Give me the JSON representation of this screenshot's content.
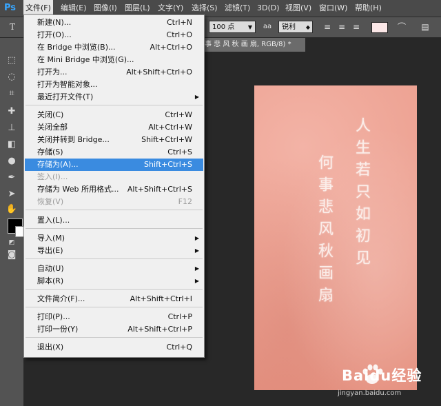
{
  "app": {
    "logo": "Ps"
  },
  "menubar": {
    "items": [
      "文件(F)",
      "编辑(E)",
      "图像(I)",
      "图层(L)",
      "文字(Y)",
      "选择(S)",
      "滤镜(T)",
      "3D(D)",
      "视图(V)",
      "窗口(W)",
      "帮助(H)"
    ],
    "active_index": 0
  },
  "options": {
    "tool_glyph": "T",
    "font_size": "100 点",
    "aa_label": "aa",
    "aa_mode": "锐利"
  },
  "document": {
    "tab_title": "事 悲 风 秋 画 扇, RGB/8) *",
    "poem_right": "人生若只如初见",
    "poem_left": "何事悲风秋画扇"
  },
  "file_menu": {
    "items": [
      {
        "label": "新建(N)...",
        "shortcut": "Ctrl+N"
      },
      {
        "label": "打开(O)...",
        "shortcut": "Ctrl+O"
      },
      {
        "label": "在 Bridge 中浏览(B)...",
        "shortcut": "Alt+Ctrl+O"
      },
      {
        "label": "在 Mini Bridge 中浏览(G)...",
        "shortcut": ""
      },
      {
        "label": "打开为...",
        "shortcut": "Alt+Shift+Ctrl+O"
      },
      {
        "label": "打开为智能对象...",
        "shortcut": ""
      },
      {
        "label": "最近打开文件(T)",
        "shortcut": ""
      },
      {
        "label": "关闭(C)",
        "shortcut": "Ctrl+W"
      },
      {
        "label": "关闭全部",
        "shortcut": "Alt+Ctrl+W"
      },
      {
        "label": "关闭并转到 Bridge...",
        "shortcut": "Shift+Ctrl+W"
      },
      {
        "label": "存储(S)",
        "shortcut": "Ctrl+S"
      },
      {
        "label": "存储为(A)...",
        "shortcut": "Shift+Ctrl+S"
      },
      {
        "label": "签入(I)...",
        "shortcut": ""
      },
      {
        "label": "存储为 Web 所用格式...",
        "shortcut": "Alt+Shift+Ctrl+S"
      },
      {
        "label": "恢复(V)",
        "shortcut": "F12"
      },
      {
        "label": "置入(L)...",
        "shortcut": ""
      },
      {
        "label": "导入(M)",
        "shortcut": ""
      },
      {
        "label": "导出(E)",
        "shortcut": ""
      },
      {
        "label": "自动(U)",
        "shortcut": ""
      },
      {
        "label": "脚本(R)",
        "shortcut": ""
      },
      {
        "label": "文件简介(F)...",
        "shortcut": "Alt+Shift+Ctrl+I"
      },
      {
        "label": "打印(P)...",
        "shortcut": "Ctrl+P"
      },
      {
        "label": "打印一份(Y)",
        "shortcut": "Alt+Shift+Ctrl+P"
      },
      {
        "label": "退出(X)",
        "shortcut": "Ctrl+Q"
      }
    ],
    "highlighted": "存储为(A)...",
    "disabled": [
      "签入(I)...",
      "恢复(V)"
    ]
  },
  "watermark": {
    "brand": "Baidu经验",
    "url": "jingyan.baidu.com"
  },
  "colors": {
    "menu_highlight": "#3a8be0",
    "artboard": "#eea596",
    "ps_blue": "#37a6ff"
  }
}
